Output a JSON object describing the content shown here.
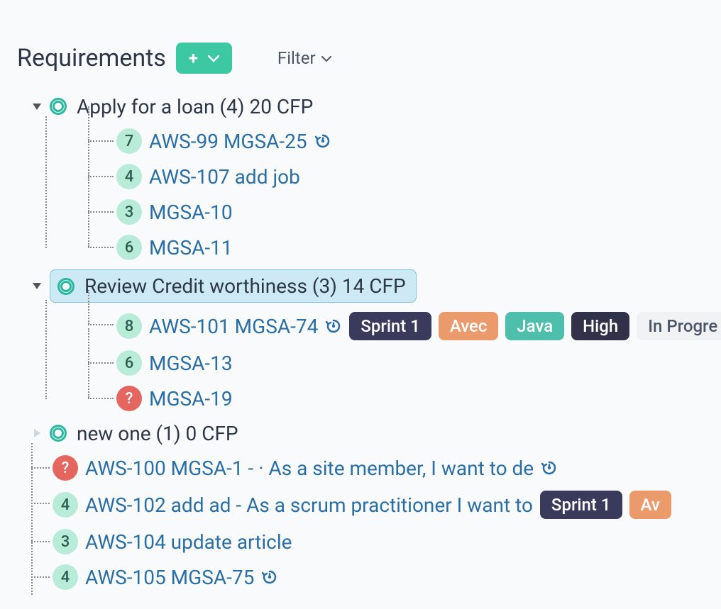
{
  "header": {
    "title": "Requirements",
    "filter_label": "Filter"
  },
  "groups": [
    {
      "title": "Apply for a loan (4) 20 CFP",
      "selected": false,
      "expanded": true,
      "items": [
        {
          "badge": "7",
          "badge_red": false,
          "label": "AWS-99 MGSA-25",
          "history": true,
          "tags": []
        },
        {
          "badge": "4",
          "badge_red": false,
          "label": "AWS-107 add job",
          "history": false,
          "tags": []
        },
        {
          "badge": "3",
          "badge_red": false,
          "label": "MGSA-10",
          "history": false,
          "tags": []
        },
        {
          "badge": "6",
          "badge_red": false,
          "label": "MGSA-11",
          "history": false,
          "tags": []
        }
      ]
    },
    {
      "title": "Review Credit worthiness (3) 14 CFP",
      "selected": true,
      "expanded": true,
      "items": [
        {
          "badge": "8",
          "badge_red": false,
          "label": "AWS-101 MGSA-74",
          "history": true,
          "tags": [
            {
              "text": "Sprint 1",
              "cls": "sprint"
            },
            {
              "text": "Avec",
              "cls": "avec"
            },
            {
              "text": "Java",
              "cls": "java"
            },
            {
              "text": "High",
              "cls": "high"
            },
            {
              "text": "In Progre",
              "cls": "status"
            }
          ]
        },
        {
          "badge": "6",
          "badge_red": false,
          "label": "MGSA-13",
          "history": false,
          "tags": []
        },
        {
          "badge": "?",
          "badge_red": true,
          "label": "MGSA-19",
          "history": false,
          "tags": []
        }
      ]
    },
    {
      "title": "new one (1) 0 CFP",
      "selected": false,
      "expanded": false,
      "items": []
    }
  ],
  "root_items": [
    {
      "badge": "?",
      "badge_red": true,
      "label": "AWS-100 MGSA-1 - · As a site member, I want to de",
      "history": true,
      "tags": []
    },
    {
      "badge": "4",
      "badge_red": false,
      "label": "AWS-102 add ad - As a scrum practitioner I want to",
      "history": false,
      "tags": [
        {
          "text": "Sprint 1",
          "cls": "sprint"
        },
        {
          "text": "Av",
          "cls": "avec"
        }
      ]
    },
    {
      "badge": "3",
      "badge_red": false,
      "label": "AWS-104 update article",
      "history": false,
      "tags": []
    },
    {
      "badge": "4",
      "badge_red": false,
      "label": "AWS-105 MGSA-75",
      "history": true,
      "tags": []
    }
  ]
}
